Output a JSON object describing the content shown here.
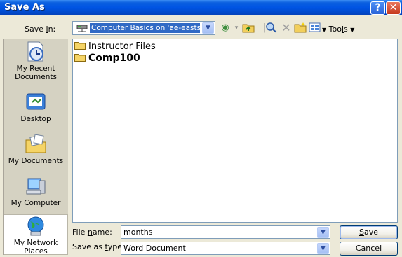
{
  "window": {
    "title": "Save As",
    "help_label": "?",
    "close_label": "✕"
  },
  "toolbar": {
    "save_in_label": "Save in:",
    "save_in_value": "Computer Basics on 'ae-easts...",
    "tools_label": "Tools"
  },
  "places": [
    {
      "label": "My Recent Documents",
      "icon": "recent-documents-icon"
    },
    {
      "label": "Desktop",
      "icon": "desktop-icon"
    },
    {
      "label": "My Documents",
      "icon": "my-documents-icon"
    },
    {
      "label": "My Computer",
      "icon": "my-computer-icon"
    },
    {
      "label": "My Network Places",
      "icon": "network-places-icon"
    }
  ],
  "files": [
    {
      "name": "Instructor Files",
      "bold": false
    },
    {
      "name": "Comp100",
      "bold": true
    }
  ],
  "form": {
    "file_name_label": "File name:",
    "file_name_value": "months",
    "save_as_type_label": "Save as type:",
    "save_as_type_value": "Word Document",
    "save_label": "Save",
    "cancel_label": "Cancel"
  },
  "colors": {
    "titlebar": "#0054e3",
    "dialog_bg": "#ECE9D8",
    "selection": "#316ac5",
    "places_bg": "#d5d2c2"
  }
}
